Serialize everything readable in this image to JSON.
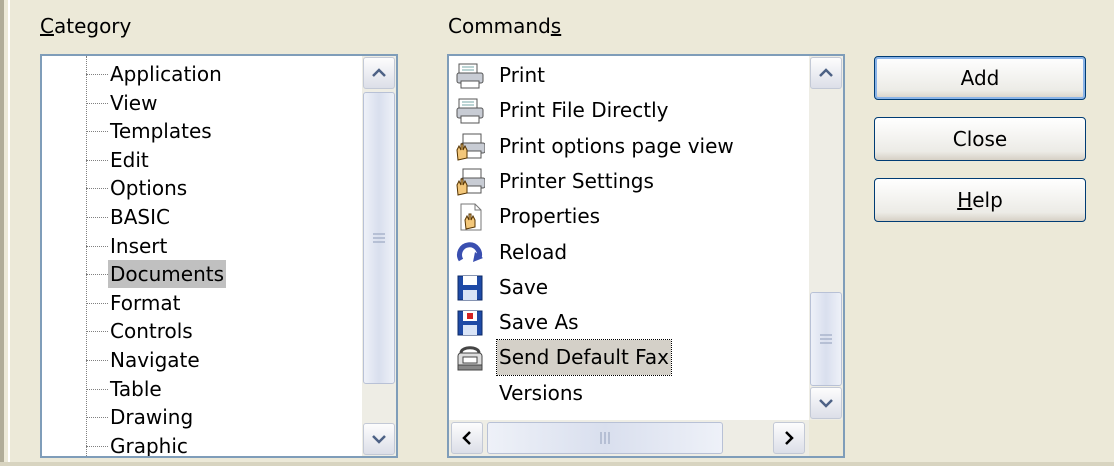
{
  "category": {
    "label_prefix": "",
    "label_mnemonic": "C",
    "label_rest": "ategory",
    "items": [
      "Application",
      "View",
      "Templates",
      "Edit",
      "Options",
      "BASIC",
      "Insert",
      "Documents",
      "Format",
      "Controls",
      "Navigate",
      "Table",
      "Drawing",
      "Graphic"
    ],
    "selected": "Documents"
  },
  "commands": {
    "label_prefix": "Command",
    "label_mnemonic": "s",
    "label_rest": "",
    "items": [
      {
        "label": "Print",
        "icon": "printer-icon"
      },
      {
        "label": "Print File Directly",
        "icon": "printer-icon"
      },
      {
        "label": "Print options page view",
        "icon": "printer-hand-icon"
      },
      {
        "label": "Printer Settings",
        "icon": "printer-hand-icon"
      },
      {
        "label": "Properties",
        "icon": "document-hand-icon"
      },
      {
        "label": "Reload",
        "icon": "reload-icon"
      },
      {
        "label": "Save",
        "icon": "floppy-disk-icon"
      },
      {
        "label": "Save As",
        "icon": "floppy-disk-red-icon"
      },
      {
        "label": "Send Default Fax",
        "icon": "fax-icon"
      },
      {
        "label": "Versions",
        "icon": ""
      }
    ],
    "focused": "Send Default Fax"
  },
  "buttons": {
    "add": "Add",
    "close": "Close",
    "help_mnemonic": "H",
    "help_rest": "elp"
  },
  "colors": {
    "dialog_bg": "#ece9d8",
    "list_border": "#7f9db9",
    "button_border": "#003c74",
    "selection_bg": "#c0c0c0"
  }
}
